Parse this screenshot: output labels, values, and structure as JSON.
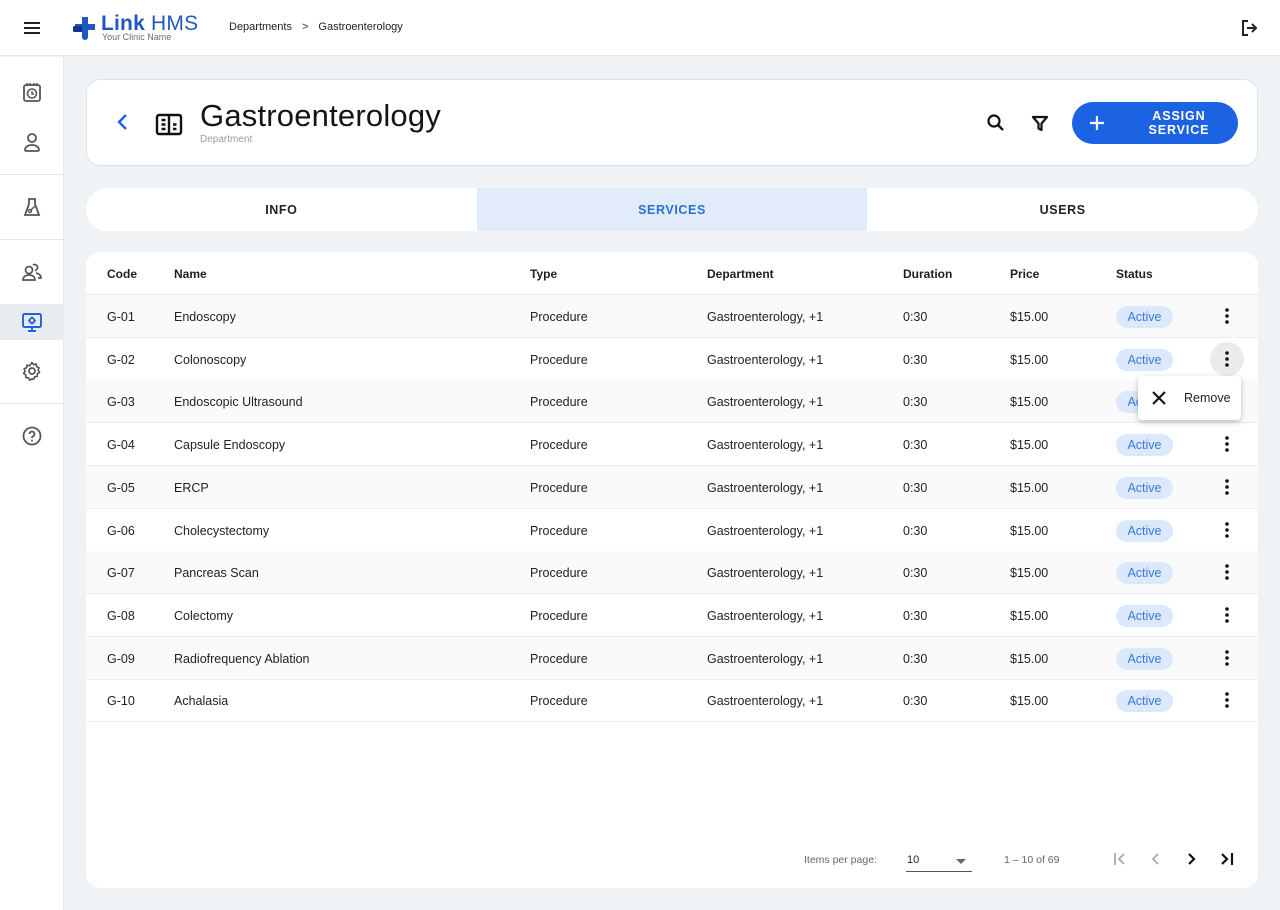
{
  "app": {
    "brand_name_bold": "Link",
    "brand_name": "HMS",
    "brand_subtitle": "Your Clinic Name"
  },
  "breadcrumb": {
    "items": [
      "Departments",
      "Gastroenterology"
    ],
    "separator": ">"
  },
  "sidebar": {
    "items": [
      {
        "icon": "calendar-clock-icon",
        "label": "Appointments"
      },
      {
        "icon": "person-icon",
        "label": "Patients"
      },
      {
        "icon": "flask-icon",
        "label": "Laboratory"
      },
      {
        "icon": "users-icon",
        "label": "Users"
      },
      {
        "icon": "monitor-settings-icon",
        "label": "Departments",
        "active": true
      },
      {
        "icon": "gear-icon",
        "label": "Settings"
      },
      {
        "icon": "help-icon",
        "label": "Help"
      }
    ]
  },
  "header": {
    "title": "Gastroenterology",
    "subtitle": "Department",
    "assign_button": "ASSIGN SERVICE"
  },
  "tabs": [
    {
      "label": "INFO",
      "active": false
    },
    {
      "label": "SERVICES",
      "active": true
    },
    {
      "label": "USERS",
      "active": false
    }
  ],
  "table": {
    "columns": [
      "Code",
      "Name",
      "Type",
      "Department",
      "Duration",
      "Price",
      "Status"
    ],
    "rows": [
      {
        "code": "G-01",
        "name": "Endoscopy",
        "type": "Procedure",
        "department": "Gastroenterology, +1",
        "duration": "0:30",
        "price": "$15.00",
        "status": "Active"
      },
      {
        "code": "G-02",
        "name": "Colonoscopy",
        "type": "Procedure",
        "department": "Gastroenterology, +1",
        "duration": "0:30",
        "price": "$15.00",
        "status": "Active"
      },
      {
        "code": "G-03",
        "name": "Endoscopic Ultrasound",
        "type": "Procedure",
        "department": "Gastroenterology, +1",
        "duration": "0:30",
        "price": "$15.00",
        "status": "Active"
      },
      {
        "code": "G-04",
        "name": "Capsule Endoscopy",
        "type": "Procedure",
        "department": "Gastroenterology, +1",
        "duration": "0:30",
        "price": "$15.00",
        "status": "Active"
      },
      {
        "code": "G-05",
        "name": "ERCP",
        "type": "Procedure",
        "department": "Gastroenterology, +1",
        "duration": "0:30",
        "price": "$15.00",
        "status": "Active"
      },
      {
        "code": "G-06",
        "name": "Cholecystectomy",
        "type": "Procedure",
        "department": "Gastroenterology, +1",
        "duration": "0:30",
        "price": "$15.00",
        "status": "Active"
      },
      {
        "code": "G-07",
        "name": "Pancreas Scan",
        "type": "Procedure",
        "department": "Gastroenterology, +1",
        "duration": "0:30",
        "price": "$15.00",
        "status": "Active"
      },
      {
        "code": "G-08",
        "name": "Colectomy",
        "type": "Procedure",
        "department": "Gastroenterology, +1",
        "duration": "0:30",
        "price": "$15.00",
        "status": "Active"
      },
      {
        "code": "G-09",
        "name": "Radiofrequency Ablation",
        "type": "Procedure",
        "department": "Gastroenterology, +1",
        "duration": "0:30",
        "price": "$15.00",
        "status": "Active"
      },
      {
        "code": "G-10",
        "name": "Achalasia",
        "type": "Procedure",
        "department": "Gastroenterology, +1",
        "duration": "0:30",
        "price": "$15.00",
        "status": "Active"
      }
    ]
  },
  "row_menu": {
    "open_for_row": "G-02",
    "items": [
      {
        "icon": "close-icon",
        "label": "Remove"
      }
    ]
  },
  "paginator": {
    "items_per_page_label": "Items per page:",
    "items_per_page_value": "10",
    "range_label": "1 – 10 of 69"
  },
  "colors": {
    "primary": "#1c63e3",
    "active_tab_bg": "#e1ebf9",
    "badge_bg": "#dce8fb",
    "badge_text": "#3a79e0"
  }
}
